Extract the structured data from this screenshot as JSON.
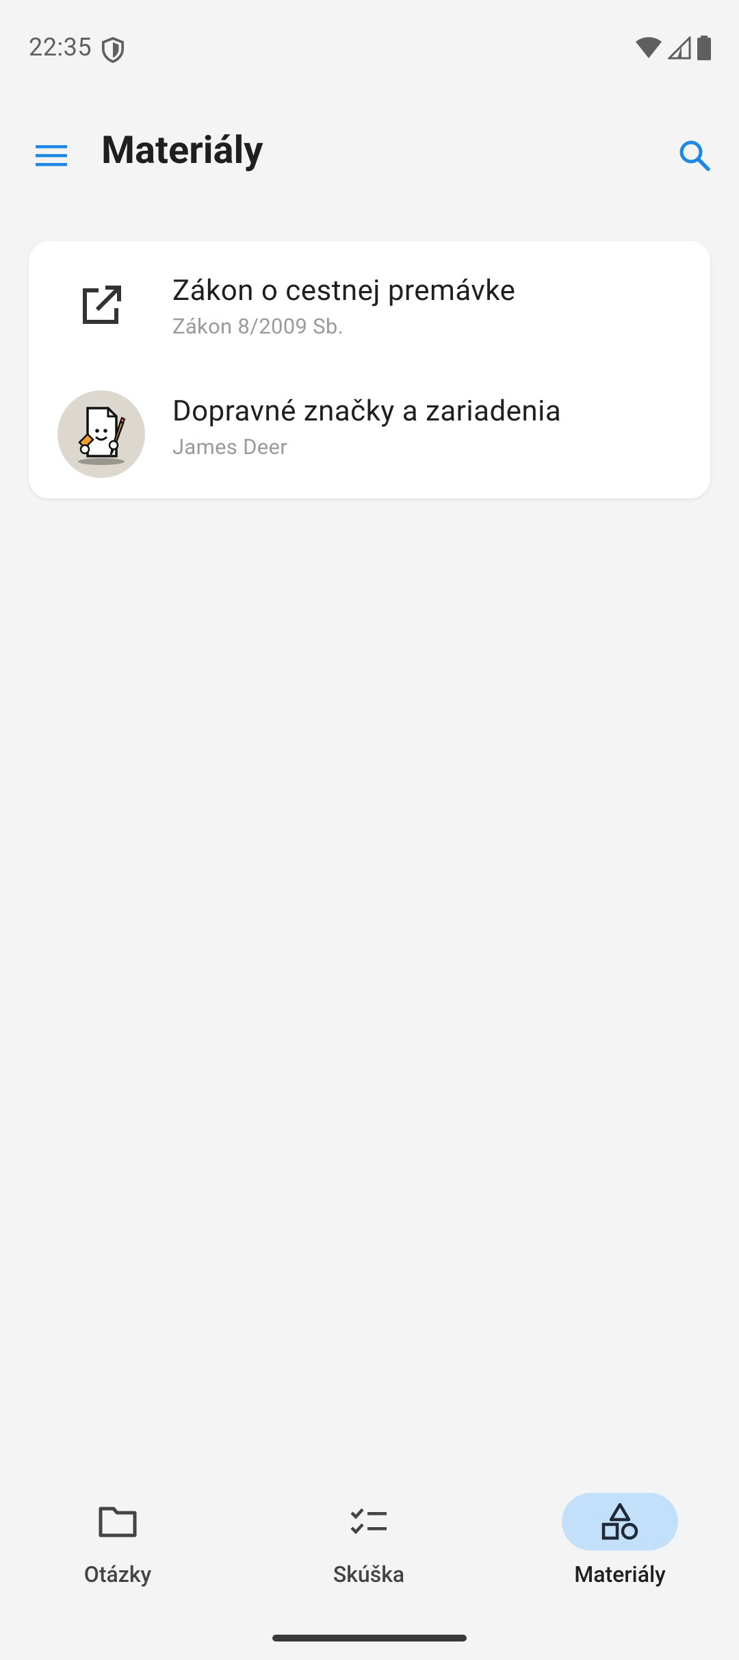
{
  "status_bar": {
    "time": "22:35",
    "icons": [
      "shield-icon",
      "wifi-icon",
      "signal-icon",
      "battery-icon"
    ]
  },
  "app_bar": {
    "title": "Materiály",
    "menu_icon": "menu-icon",
    "search_icon": "search-icon",
    "accent_color": "#1e88e5"
  },
  "materials": [
    {
      "title": "Zákon o cestnej premávke",
      "subtitle": "Zákon 8/2009 Sb.",
      "icon": "open-external-icon"
    },
    {
      "title": "Dopravné značky a zariadenia",
      "subtitle": "James Deer",
      "icon": "author-avatar"
    }
  ],
  "bottom_nav": {
    "items": [
      {
        "label": "Otázky",
        "icon": "folder-icon",
        "active": false
      },
      {
        "label": "Skúška",
        "icon": "checklist-icon",
        "active": false
      },
      {
        "label": "Materiály",
        "icon": "shapes-icon",
        "active": true
      }
    ],
    "active_color": "#c2e0fa"
  }
}
